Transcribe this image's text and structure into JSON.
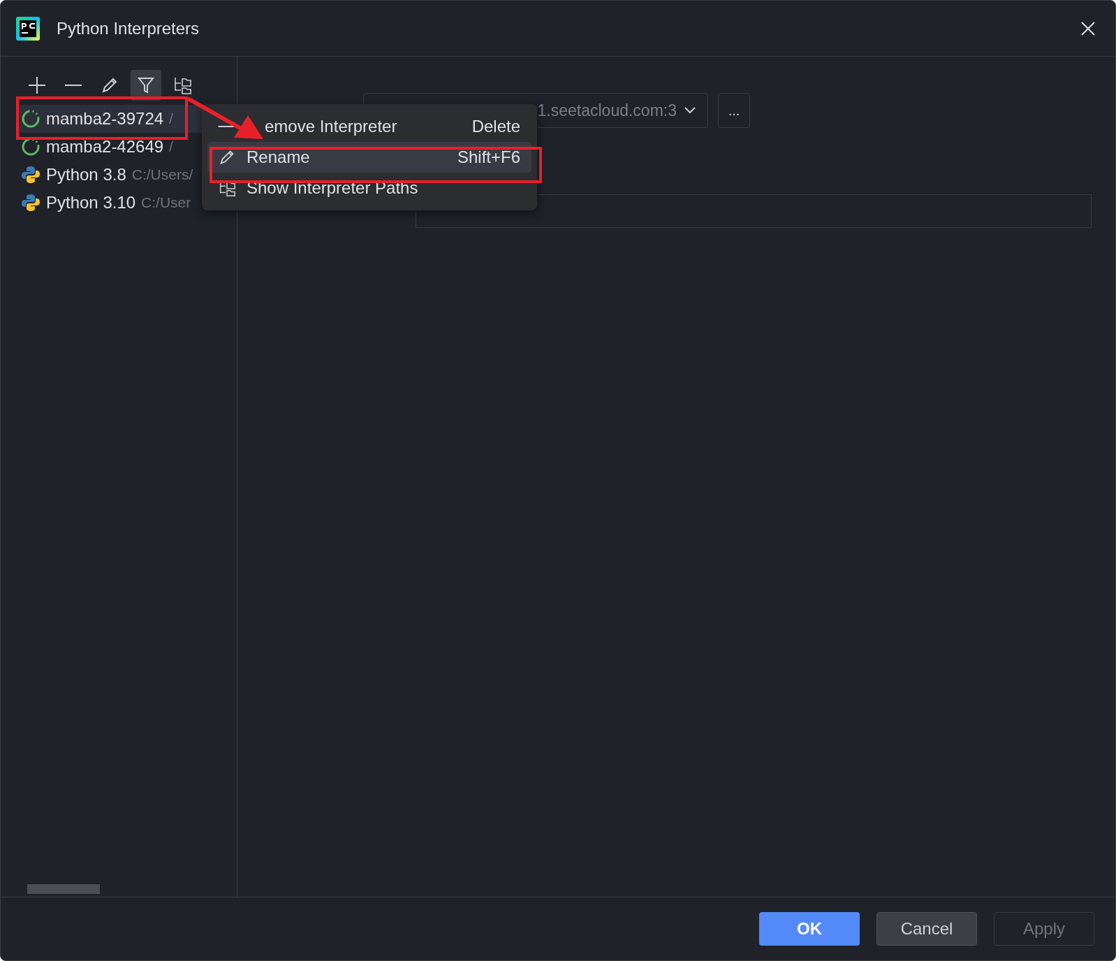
{
  "window": {
    "title": "Python Interpreters"
  },
  "toolbar": [
    {
      "kind": "add",
      "selected": false
    },
    {
      "kind": "remove",
      "selected": false
    },
    {
      "kind": "edit",
      "selected": false
    },
    {
      "kind": "filter",
      "selected": true
    },
    {
      "kind": "paths",
      "selected": false
    }
  ],
  "interpreters": [
    {
      "kind": "remote",
      "name": "mamba2-39724",
      "path": "/",
      "selected": true
    },
    {
      "kind": "remote",
      "name": "mamba2-42649",
      "path": "/",
      "selected": false
    },
    {
      "kind": "python",
      "name": "Python 3.8",
      "path": "C:/Users/",
      "selected": false
    },
    {
      "kind": "python",
      "name": "Python 3.10",
      "path": "C:/User",
      "selected": false
    }
  ],
  "ssh_server": {
    "value": "1.seetacloud.com:3",
    "more": "..."
  },
  "context_menu": [
    {
      "kind": "remove",
      "label": "emove Interpreter",
      "shortcut": "Delete",
      "selected": false
    },
    {
      "kind": "edit",
      "label": "Rename",
      "shortcut": "Shift+F6",
      "selected": true
    },
    {
      "kind": "paths",
      "label": "Show Interpreter Paths",
      "selected": false
    }
  ],
  "buttons": [
    {
      "label": "OK",
      "kind": "primary"
    },
    {
      "label": "Cancel",
      "kind": "normal"
    },
    {
      "label": "Apply",
      "kind": "disabled"
    }
  ]
}
